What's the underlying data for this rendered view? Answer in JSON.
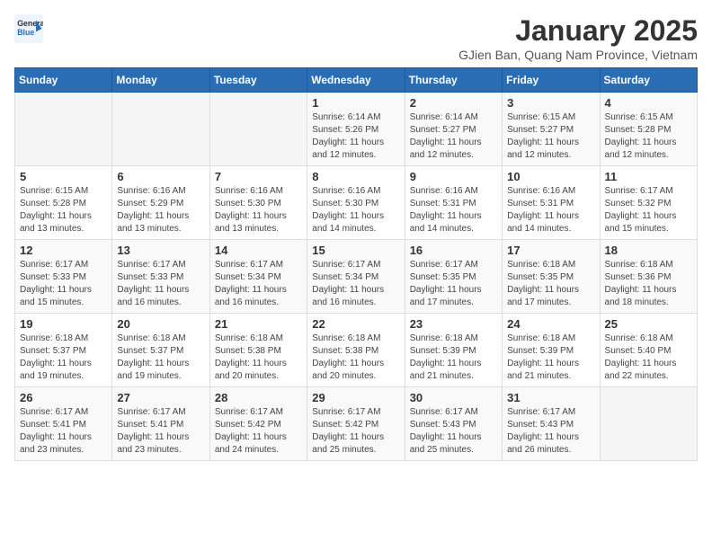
{
  "header": {
    "logo": {
      "general": "General",
      "blue": "Blue"
    },
    "title": "January 2025",
    "subtitle": "GJien Ban, Quang Nam Province, Vietnam"
  },
  "days_of_week": [
    "Sunday",
    "Monday",
    "Tuesday",
    "Wednesday",
    "Thursday",
    "Friday",
    "Saturday"
  ],
  "weeks": [
    [
      {
        "day": "",
        "info": ""
      },
      {
        "day": "",
        "info": ""
      },
      {
        "day": "",
        "info": ""
      },
      {
        "day": "1",
        "info": "Sunrise: 6:14 AM\nSunset: 5:26 PM\nDaylight: 11 hours and 12 minutes."
      },
      {
        "day": "2",
        "info": "Sunrise: 6:14 AM\nSunset: 5:27 PM\nDaylight: 11 hours and 12 minutes."
      },
      {
        "day": "3",
        "info": "Sunrise: 6:15 AM\nSunset: 5:27 PM\nDaylight: 11 hours and 12 minutes."
      },
      {
        "day": "4",
        "info": "Sunrise: 6:15 AM\nSunset: 5:28 PM\nDaylight: 11 hours and 12 minutes."
      }
    ],
    [
      {
        "day": "5",
        "info": "Sunrise: 6:15 AM\nSunset: 5:28 PM\nDaylight: 11 hours and 13 minutes."
      },
      {
        "day": "6",
        "info": "Sunrise: 6:16 AM\nSunset: 5:29 PM\nDaylight: 11 hours and 13 minutes."
      },
      {
        "day": "7",
        "info": "Sunrise: 6:16 AM\nSunset: 5:30 PM\nDaylight: 11 hours and 13 minutes."
      },
      {
        "day": "8",
        "info": "Sunrise: 6:16 AM\nSunset: 5:30 PM\nDaylight: 11 hours and 14 minutes."
      },
      {
        "day": "9",
        "info": "Sunrise: 6:16 AM\nSunset: 5:31 PM\nDaylight: 11 hours and 14 minutes."
      },
      {
        "day": "10",
        "info": "Sunrise: 6:16 AM\nSunset: 5:31 PM\nDaylight: 11 hours and 14 minutes."
      },
      {
        "day": "11",
        "info": "Sunrise: 6:17 AM\nSunset: 5:32 PM\nDaylight: 11 hours and 15 minutes."
      }
    ],
    [
      {
        "day": "12",
        "info": "Sunrise: 6:17 AM\nSunset: 5:33 PM\nDaylight: 11 hours and 15 minutes."
      },
      {
        "day": "13",
        "info": "Sunrise: 6:17 AM\nSunset: 5:33 PM\nDaylight: 11 hours and 16 minutes."
      },
      {
        "day": "14",
        "info": "Sunrise: 6:17 AM\nSunset: 5:34 PM\nDaylight: 11 hours and 16 minutes."
      },
      {
        "day": "15",
        "info": "Sunrise: 6:17 AM\nSunset: 5:34 PM\nDaylight: 11 hours and 16 minutes."
      },
      {
        "day": "16",
        "info": "Sunrise: 6:17 AM\nSunset: 5:35 PM\nDaylight: 11 hours and 17 minutes."
      },
      {
        "day": "17",
        "info": "Sunrise: 6:18 AM\nSunset: 5:35 PM\nDaylight: 11 hours and 17 minutes."
      },
      {
        "day": "18",
        "info": "Sunrise: 6:18 AM\nSunset: 5:36 PM\nDaylight: 11 hours and 18 minutes."
      }
    ],
    [
      {
        "day": "19",
        "info": "Sunrise: 6:18 AM\nSunset: 5:37 PM\nDaylight: 11 hours and 19 minutes."
      },
      {
        "day": "20",
        "info": "Sunrise: 6:18 AM\nSunset: 5:37 PM\nDaylight: 11 hours and 19 minutes."
      },
      {
        "day": "21",
        "info": "Sunrise: 6:18 AM\nSunset: 5:38 PM\nDaylight: 11 hours and 20 minutes."
      },
      {
        "day": "22",
        "info": "Sunrise: 6:18 AM\nSunset: 5:38 PM\nDaylight: 11 hours and 20 minutes."
      },
      {
        "day": "23",
        "info": "Sunrise: 6:18 AM\nSunset: 5:39 PM\nDaylight: 11 hours and 21 minutes."
      },
      {
        "day": "24",
        "info": "Sunrise: 6:18 AM\nSunset: 5:39 PM\nDaylight: 11 hours and 21 minutes."
      },
      {
        "day": "25",
        "info": "Sunrise: 6:18 AM\nSunset: 5:40 PM\nDaylight: 11 hours and 22 minutes."
      }
    ],
    [
      {
        "day": "26",
        "info": "Sunrise: 6:17 AM\nSunset: 5:41 PM\nDaylight: 11 hours and 23 minutes."
      },
      {
        "day": "27",
        "info": "Sunrise: 6:17 AM\nSunset: 5:41 PM\nDaylight: 11 hours and 23 minutes."
      },
      {
        "day": "28",
        "info": "Sunrise: 6:17 AM\nSunset: 5:42 PM\nDaylight: 11 hours and 24 minutes."
      },
      {
        "day": "29",
        "info": "Sunrise: 6:17 AM\nSunset: 5:42 PM\nDaylight: 11 hours and 25 minutes."
      },
      {
        "day": "30",
        "info": "Sunrise: 6:17 AM\nSunset: 5:43 PM\nDaylight: 11 hours and 25 minutes."
      },
      {
        "day": "31",
        "info": "Sunrise: 6:17 AM\nSunset: 5:43 PM\nDaylight: 11 hours and 26 minutes."
      },
      {
        "day": "",
        "info": ""
      }
    ]
  ]
}
